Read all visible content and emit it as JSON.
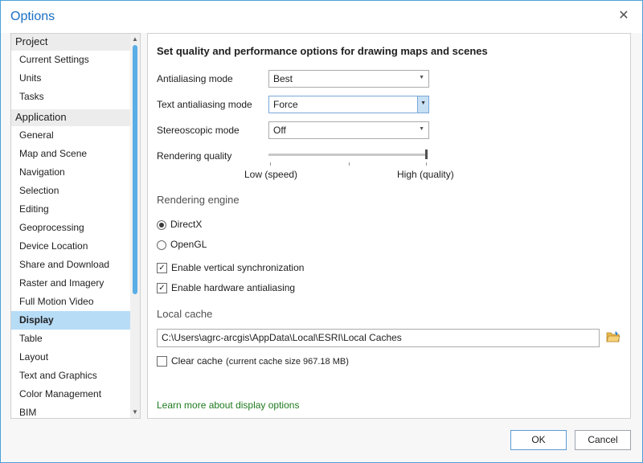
{
  "window": {
    "title": "Options",
    "close_glyph": "✕"
  },
  "sidebar": {
    "groups": [
      {
        "header": "Project",
        "items": [
          "Current Settings",
          "Units",
          "Tasks"
        ]
      },
      {
        "header": "Application",
        "items": [
          "General",
          "Map and Scene",
          "Navigation",
          "Selection",
          "Editing",
          "Geoprocessing",
          "Device Location",
          "Share and Download",
          "Raster and Imagery",
          "Full Motion Video",
          "Display",
          "Table",
          "Layout",
          "Text and Graphics",
          "Color Management",
          "BIM"
        ]
      }
    ],
    "selected": "Display"
  },
  "display": {
    "heading": "Set quality and performance options for drawing maps and scenes",
    "antialiasing": {
      "label": "Antialiasing mode",
      "value": "Best"
    },
    "text_antialiasing": {
      "label": "Text antialiasing mode",
      "value": "Force"
    },
    "stereoscopic": {
      "label": "Stereoscopic mode",
      "value": "Off"
    },
    "rendering_quality": {
      "label": "Rendering quality",
      "low_label": "Low (speed)",
      "high_label": "High (quality)",
      "level": 1.0
    },
    "rendering_engine": {
      "title": "Rendering engine",
      "options": [
        "DirectX",
        "OpenGL"
      ],
      "selected": "DirectX"
    },
    "vsync": {
      "label": "Enable vertical synchronization",
      "checked": true
    },
    "hw_antialias": {
      "label": "Enable hardware antialiasing",
      "checked": true
    },
    "local_cache": {
      "title": "Local cache",
      "path": "C:\\Users\\agrc-arcgis\\AppData\\Local\\ESRI\\Local Caches"
    },
    "clear_cache": {
      "label": "Clear cache",
      "size_note": "(current cache size 967.18 MB)",
      "checked": false
    },
    "learn_more": "Learn more about display options"
  },
  "buttons": {
    "ok": "OK",
    "cancel": "Cancel"
  },
  "icons": {
    "close": "close-icon",
    "folder": "folder-open-icon",
    "dropdown": "chevron-down-icon"
  },
  "colors": {
    "accent": "#1b6ec2",
    "selected_bg": "#b7dcf6",
    "link": "#1e7a1e"
  }
}
